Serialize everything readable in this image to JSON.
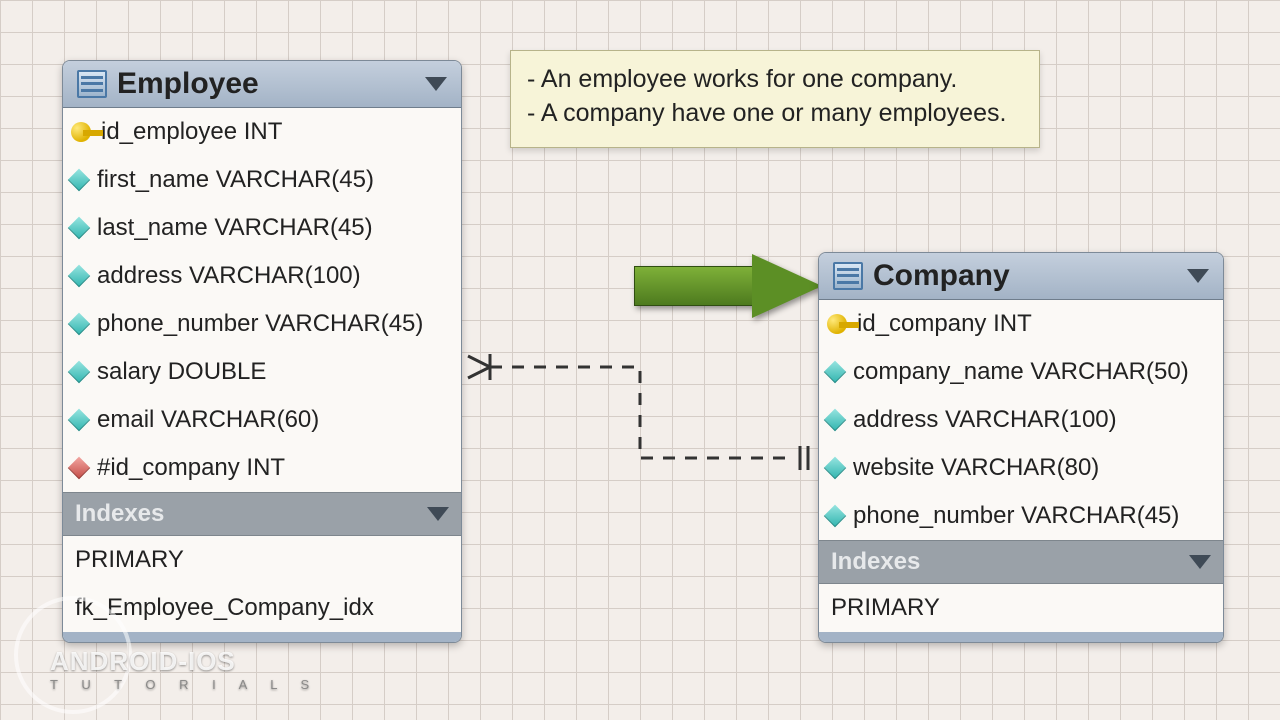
{
  "note": {
    "line1": "- An employee works for one company.",
    "line2": "- A company have one or many employees."
  },
  "tables": {
    "employee": {
      "title": "Employee",
      "columns": [
        {
          "icon": "key",
          "label": "id_employee INT"
        },
        {
          "icon": "col",
          "label": "first_name VARCHAR(45)"
        },
        {
          "icon": "col",
          "label": "last_name VARCHAR(45)"
        },
        {
          "icon": "col",
          "label": "address VARCHAR(100)"
        },
        {
          "icon": "col",
          "label": "phone_number VARCHAR(45)"
        },
        {
          "icon": "col",
          "label": "salary DOUBLE"
        },
        {
          "icon": "col",
          "label": "email VARCHAR(60)"
        },
        {
          "icon": "fk",
          "label": "#id_company INT"
        }
      ],
      "indexes_header": "Indexes",
      "indexes": [
        "PRIMARY",
        "fk_Employee_Company_idx"
      ]
    },
    "company": {
      "title": "Company",
      "columns": [
        {
          "icon": "key",
          "label": "id_company INT"
        },
        {
          "icon": "col",
          "label": "company_name VARCHAR(50)"
        },
        {
          "icon": "col",
          "label": "address VARCHAR(100)"
        },
        {
          "icon": "col",
          "label": "website VARCHAR(80)"
        },
        {
          "icon": "col",
          "label": "phone_number VARCHAR(45)"
        }
      ],
      "indexes_header": "Indexes",
      "indexes": [
        "PRIMARY"
      ]
    }
  },
  "watermark": {
    "line1": "ANDROID-IOS",
    "line2": "T U T O R I A L S"
  }
}
